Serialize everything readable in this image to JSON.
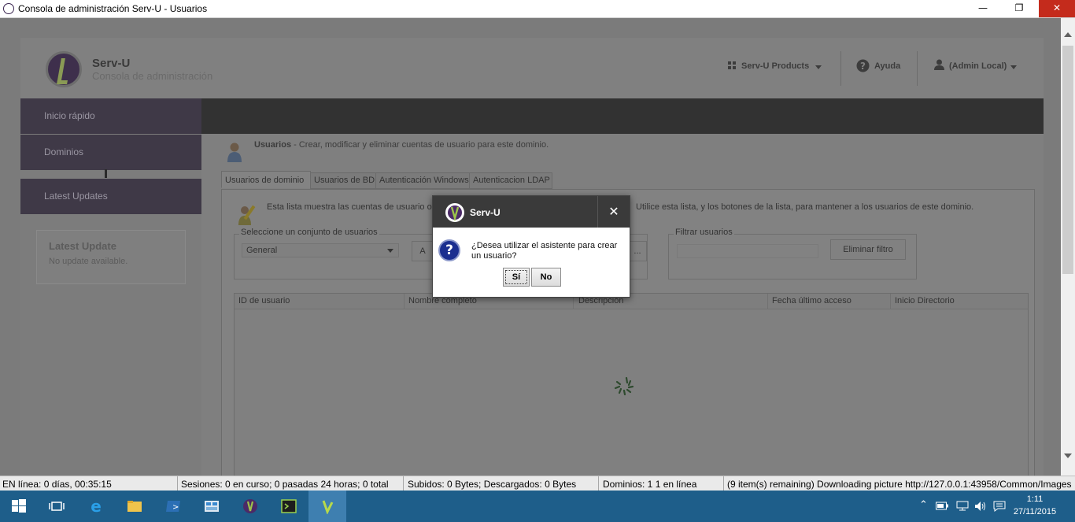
{
  "window": {
    "title": "Consola de administración Serv-U - Usuarios",
    "minimize": "—",
    "restore": "❐",
    "close": "✕"
  },
  "header": {
    "brand": "Serv-U",
    "subtitle": "Consola de administración",
    "products_label": "Serv-U Products",
    "help_label": "Ayuda",
    "user_label": "(Admin Local)"
  },
  "sidebar": {
    "items": [
      {
        "label": "Inicio rápido"
      },
      {
        "label": "Dominios"
      },
      {
        "label": "Latest Updates"
      }
    ],
    "latest_box": {
      "title": "Latest Update",
      "text": "No update available."
    }
  },
  "content": {
    "section_title": "Usuarios",
    "section_desc": " - Crear, modificar y eliminar cuentas de usuario para este dominio.",
    "tabs": [
      {
        "label": "Usuarios de dominio",
        "active": true
      },
      {
        "label": "Usuarios de BD",
        "active": false
      },
      {
        "label": "Autenticación Windows",
        "active": false
      },
      {
        "label": "Autenticacion LDAP",
        "active": false
      }
    ],
    "desc_left": "Esta lista muestra las cuentas de usuario o",
    "desc_right": "Utilice esta lista, y los botones de la lista, para mantener a los usuarios de este dominio.",
    "user_set": {
      "legend": "Seleccione un conjunto de usuarios",
      "selected": "General",
      "button_partial": "A",
      "button_partial2": "..."
    },
    "filter": {
      "legend": "Filtrar usuarios",
      "value": "",
      "clear_button": "Eliminar filtro"
    },
    "table": {
      "columns": [
        "ID de usuario",
        "Nombre completo",
        "Descripción",
        "Fecha último acceso",
        "Inicio Directorio"
      ]
    }
  },
  "dialog": {
    "title": "Serv-U",
    "close": "✕",
    "message": "¿Desea utilizar el asistente para crear un usuario?",
    "yes": "Sí",
    "no": "No"
  },
  "statusbar": {
    "online": "EN línea: 0 días, 00:35:15",
    "sessions": "Sesiones: 0 en curso; 0 pasadas 24 horas; 0 total",
    "transfer": "Subidos: 0 Bytes; Descargados: 0 Bytes",
    "domains": "Dominios: 1 1 en línea",
    "download": "(9 item(s) remaining) Downloading picture http://127.0.0.1:43958/Common/Images"
  },
  "taskbar": {
    "time": "1:11",
    "date": "27/11/2015"
  },
  "colors": {
    "dialog_header": "#3a3a3a",
    "sidebar_item": "#3f3947",
    "taskbar": "#1e5e8a",
    "close_red": "#c42b1c"
  }
}
